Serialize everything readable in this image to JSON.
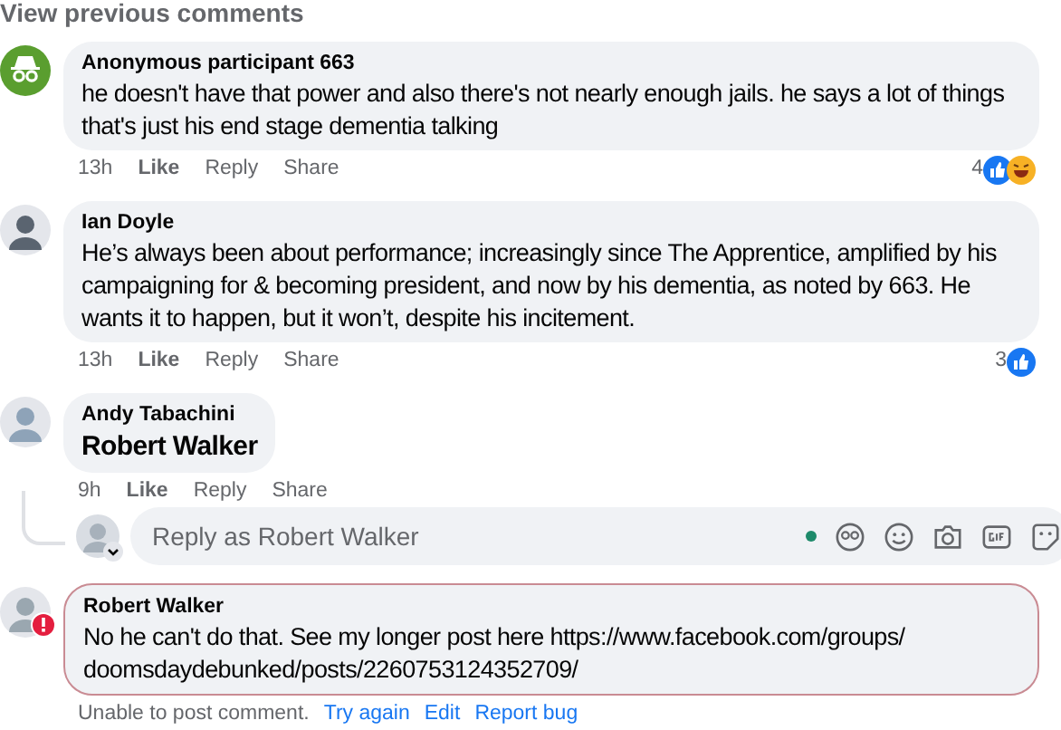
{
  "view_previous": "View previous comments",
  "comments": [
    {
      "author": "Anonymous participant 663",
      "anonymous": true,
      "text": "he doesn't have that power and also there's not nearly enough jails. he says a lot of things that's just his end stage dementia talking",
      "mention": false,
      "failed": false,
      "time": "13h",
      "actions": [
        "Like",
        "Reply",
        "Share"
      ],
      "reaction_count": "4",
      "reactions": [
        {
          "kind": "like"
        },
        {
          "kind": "haha"
        }
      ]
    },
    {
      "author": "Ian Doyle",
      "anonymous": false,
      "text": "He’s always been about performance; increasingly since The Apprentice, amplified by his campaigning for & becoming president, and now by his dementia, as noted by 663. He wants it to happen, but it won’t, despite his incitement.",
      "mention": false,
      "failed": false,
      "time": "13h",
      "actions": [
        "Like",
        "Reply",
        "Share"
      ],
      "reaction_count": "3",
      "reactions": [
        {
          "kind": "like"
        }
      ]
    },
    {
      "author": "Andy Tabachini",
      "anonymous": false,
      "text": "Robert Walker",
      "mention": true,
      "failed": false,
      "time": "9h",
      "actions": [
        "Like",
        "Reply",
        "Share"
      ],
      "reply_box": {
        "placeholder": "Reply as Robert Walker"
      }
    },
    {
      "author": "Robert Walker",
      "anonymous": false,
      "text": "No he can't do that. See my longer post here https://www.facebook.com/groups/doomsdaydebunked/posts/2260753124352709/",
      "mention": false,
      "failed": true,
      "error": "Unable to post comment.",
      "actions": [
        "Try again",
        "Edit",
        "Report bug"
      ]
    }
  ]
}
